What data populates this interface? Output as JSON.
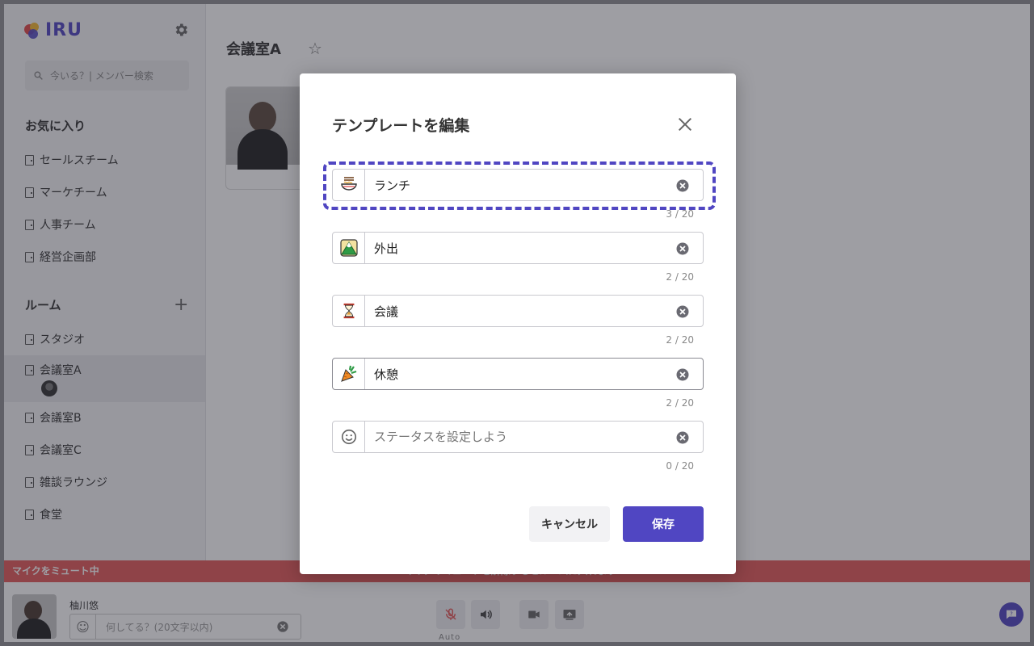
{
  "app": {
    "logo_text": "IRU"
  },
  "sidebar": {
    "search_placeholder": "今いる？| メンバー検索",
    "favorites_title": "お気に入り",
    "favorites": [
      "セールスチーム",
      "マーケチーム",
      "人事チーム",
      "経営企画部"
    ],
    "rooms_title": "ルーム",
    "rooms": [
      "スタジオ",
      "会議室A",
      "会議室B",
      "会議室C",
      "雑談ラウンジ",
      "食堂"
    ]
  },
  "main": {
    "title": "会議室A"
  },
  "bottom": {
    "mute_banner": "マイクをミュート中",
    "mute_center": "マイクのミュートを解除するとルームに入れます",
    "user_name": "柚川悠",
    "status_placeholder": "何してる？(20文字以内)",
    "auto_label": "Auto"
  },
  "modal": {
    "title": "テンプレートを編集",
    "templates": [
      {
        "icon": "ramen-bowl-icon",
        "value": "ランチ",
        "placeholder": "",
        "counter": "3 / 20"
      },
      {
        "icon": "mountain-icon",
        "value": "外出",
        "placeholder": "",
        "counter": "2 / 20"
      },
      {
        "icon": "hourglass-icon",
        "value": "会議",
        "placeholder": "",
        "counter": "2 / 20"
      },
      {
        "icon": "carrot-icon",
        "value": "休憩",
        "placeholder": "",
        "counter": "2 / 20"
      },
      {
        "icon": "smiley-icon",
        "value": "",
        "placeholder": "ステータスを設定しよう",
        "counter": "0 / 20"
      }
    ],
    "cancel_label": "キャンセル",
    "save_label": "保存"
  },
  "colors": {
    "accent": "#5046c2",
    "mute": "#e35a5a"
  }
}
